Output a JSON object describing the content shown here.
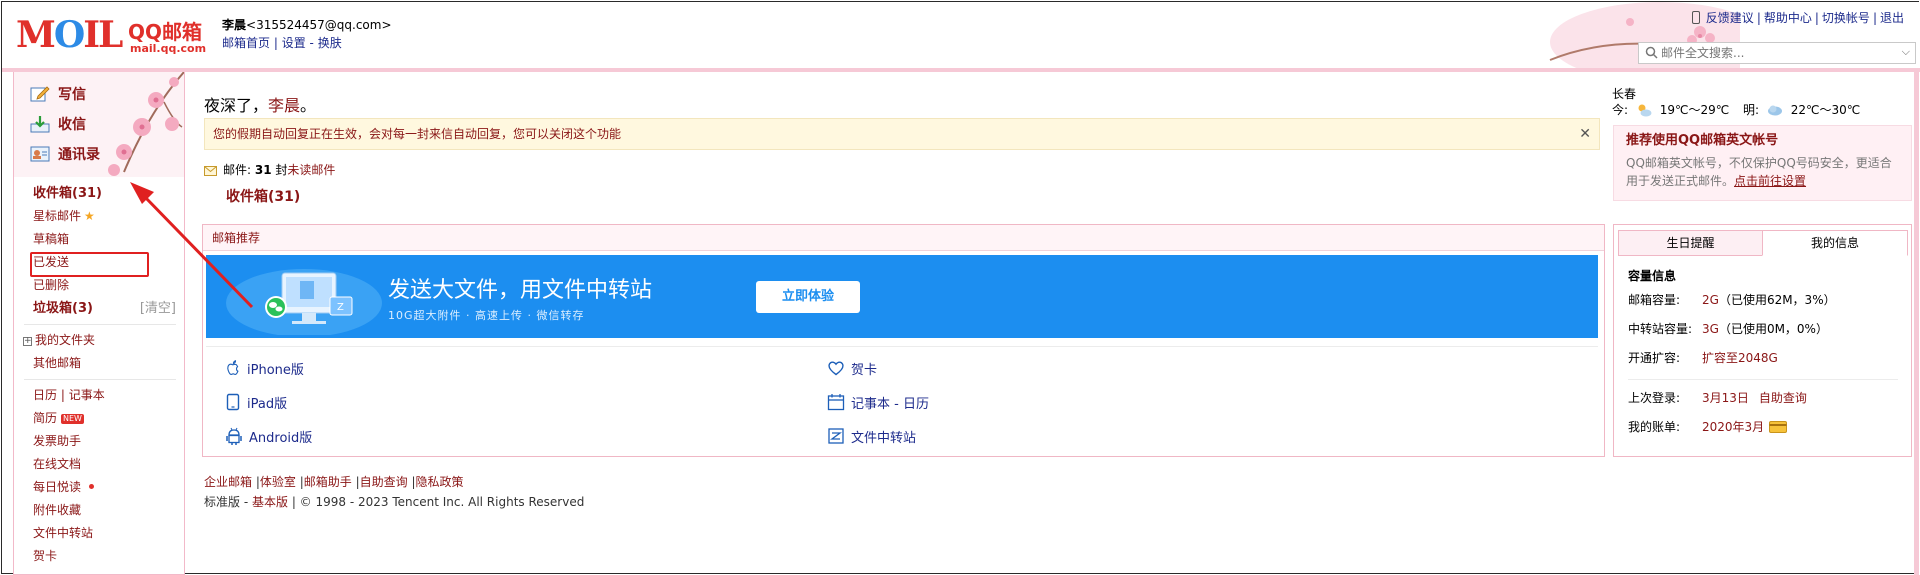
{
  "header": {
    "logo_letters": "MOIL",
    "logo_qq": "QQ邮箱",
    "logo_url": "mail.qq.com",
    "user_name": "李晨",
    "user_email": "<315524457@qq.com>",
    "link_home": "邮箱首页",
    "link_settings": "设置",
    "link_skin": "换肤",
    "top_links": [
      "反馈建议",
      "帮助中心",
      "切换帐号",
      "退出"
    ],
    "search_placeholder": "邮件全文搜索..."
  },
  "nav": {
    "write": "写信",
    "receive": "收信",
    "contacts": "通讯录",
    "items": [
      {
        "label": "收件箱(31)"
      },
      {
        "label": "星标邮件"
      },
      {
        "label": "草稿箱"
      },
      {
        "label": "已发送"
      },
      {
        "label": "已删除"
      },
      {
        "label": "垃圾箱(3)",
        "action": "[清空]"
      },
      {
        "label": "我的文件夹"
      },
      {
        "label": "其他邮箱"
      },
      {
        "label": "日历",
        "extra": "记事本"
      },
      {
        "label": "简历",
        "badge": "NEW"
      },
      {
        "label": "发票助手"
      },
      {
        "label": "在线文档"
      },
      {
        "label": "每日悦读"
      },
      {
        "label": "附件收藏"
      },
      {
        "label": "文件中转站"
      },
      {
        "label": "贺卡"
      }
    ]
  },
  "main": {
    "greeting_prefix": "夜深了，",
    "greeting_name": "李晨",
    "greeting_suffix": "。",
    "autoreply_notice": "您的假期自动回复正在生效，会对每一封来信自动回复，您可以关闭这个功能",
    "mail_label": "邮件:",
    "mail_count": "31",
    "mail_unit": "封",
    "mail_unread": "未读邮件",
    "inbox_link": "收件箱(31)",
    "recommend": {
      "title": "邮箱推荐",
      "banner_title": "发送大文件，用文件中转站",
      "banner_sub": "10G超大附件 · 高速上传 · 微信转存",
      "banner_button": "立即体验",
      "items": [
        "iPhone版",
        "iPad版",
        "Android版",
        "贺卡",
        "记事本 - 日历",
        "文件中转站"
      ]
    },
    "footer": {
      "links": [
        "企业邮箱",
        "体验室",
        "邮箱助手",
        "自助查询",
        "隐私政策"
      ],
      "version_std": "标准版",
      "version_basic": "基本版",
      "copyright": "| © 1998 - 2023 Tencent Inc. All Rights Reserved"
    }
  },
  "sidebar": {
    "city": "长春",
    "today_label": "今:",
    "today_temp": "19℃～29℃",
    "tomorrow_label": "明:",
    "tomorrow_temp": "22℃～30℃",
    "eng_title": "推荐使用QQ邮箱英文帐号",
    "eng_desc": "QQ邮箱英文帐号，不仅保护QQ号码安全，更适合用于发送正式邮件。",
    "eng_link": "点击前往设置",
    "tab_birthday": "生日提醒",
    "tab_myinfo": "我的信息",
    "capacity_title": "容量信息",
    "rows": [
      {
        "k": "邮箱容量:",
        "v": "2G",
        "g": "（已使用62M，3%）"
      },
      {
        "k": "中转站容量:",
        "v": "3G",
        "g": "（已使用0M，0%）"
      },
      {
        "k": "开通扩容:",
        "v": "扩容至2048G",
        "g": ""
      }
    ],
    "last_login_label": "上次登录:",
    "last_login_value": "3月13日",
    "last_login_link": "自助查询",
    "bill_label": "我的账单:",
    "bill_value": "2020年3月"
  }
}
